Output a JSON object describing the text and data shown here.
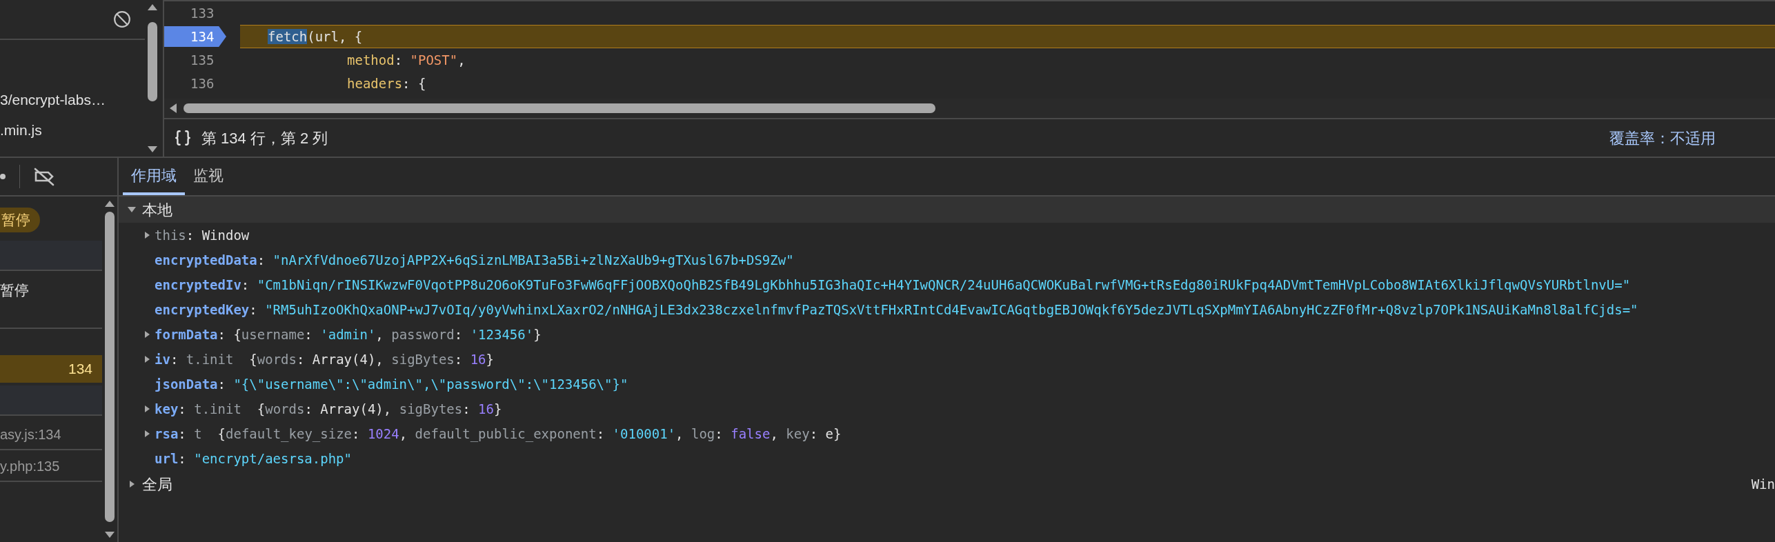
{
  "sources": {
    "files": [
      {
        "name": "3/encrypt-labs…"
      },
      {
        "name": ".min.js"
      }
    ]
  },
  "editor": {
    "lines": [
      {
        "number": "133",
        "paused": false,
        "kind": "blank"
      },
      {
        "number": "134",
        "paused": true,
        "kind": "call",
        "tokens": [
          {
            "text": "fetch",
            "kind": "selected"
          },
          {
            "text": "(url, {",
            "kind": "plain"
          }
        ]
      },
      {
        "number": "135",
        "paused": false,
        "kind": "member",
        "tokens": [
          {
            "text": "method",
            "kind": "property"
          },
          {
            "text": ": ",
            "kind": "plain"
          },
          {
            "text": "\"POST\"",
            "kind": "codestring"
          },
          {
            "text": ",",
            "kind": "plain"
          }
        ]
      },
      {
        "number": "136",
        "paused": false,
        "kind": "member",
        "tokens": [
          {
            "text": "headers",
            "kind": "property"
          },
          {
            "text": ": {",
            "kind": "plain"
          }
        ]
      }
    ]
  },
  "status_bar": {
    "cursor": "第 134 行，第 2 列",
    "coverage": "覆盖率：不适用"
  },
  "debugger_sidebar": {
    "items": [
      {
        "kind": "pill",
        "text": "暂停"
      },
      {
        "kind": "blank"
      },
      {
        "kind": "text",
        "text": "暂停"
      },
      {
        "kind": "breakpoint",
        "text": "134"
      },
      {
        "kind": "blank"
      },
      {
        "kind": "frame",
        "text": "asy.js:134"
      },
      {
        "kind": "frame",
        "text": "y.php:135"
      }
    ]
  },
  "scope_tabs": [
    {
      "label": "作用域",
      "selected": true
    },
    {
      "label": "监视",
      "selected": false
    }
  ],
  "scope": {
    "sections": [
      {
        "label": "本地",
        "expanded": true,
        "children": [
          {
            "name": "this",
            "dimmed": true,
            "expandable": true,
            "value": [
              {
                "text": ": ",
                "kind": "plain"
              },
              {
                "text": "Window",
                "kind": "object"
              }
            ]
          },
          {
            "name": "encryptedData",
            "dimmed": false,
            "expandable": false,
            "value": [
              {
                "text": ": ",
                "kind": "plain"
              },
              {
                "text": "\"nArXfVdnoe67UzojAPP2X+6qSiznLMBAI3a5Bi+zlNzXaUb9+gTXusl67b+DS9Zw\"",
                "kind": "string"
              }
            ]
          },
          {
            "name": "encryptedIv",
            "dimmed": false,
            "expandable": false,
            "value": [
              {
                "text": ": ",
                "kind": "plain"
              },
              {
                "text": "\"Cm1bNiqn/rINSIKwzwF0VqotPP8u2O6oK9TuFo3FwW6qFFjOOBXQoQhB2SfB49LgKbhhu5IG3haQIc+H4YIwQNCR/24uUH6aQCWOKuBalrwfVMG+tRsEdg80iRUkFpq4ADVmtTemHVpLCobo8WIAt6XlkiJflqwQVsYURbtlnvU=\"",
                "kind": "string"
              }
            ]
          },
          {
            "name": "encryptedKey",
            "dimmed": false,
            "expandable": false,
            "value": [
              {
                "text": ": ",
                "kind": "plain"
              },
              {
                "text": "\"RM5uhIzoOKhQxaONP+wJ7vOIq/y0yVwhinxLXaxrO2/nNHGAjLE3dx238czxelnfmvfPazTQSxVttFHxRIntCd4EvawICAGqtbgEBJOWqkf6Y5dezJVTLqSXpMmYIA6AbnyHCzZF0fMr+Q8vzlp7OPk1NSAUiKaMn8l8alfCjds=\"",
                "kind": "string"
              }
            ]
          },
          {
            "name": "formData",
            "dimmed": false,
            "expandable": true,
            "value": [
              {
                "text": ": {",
                "kind": "plain"
              },
              {
                "text": "username",
                "kind": "key"
              },
              {
                "text": ": ",
                "kind": "plain"
              },
              {
                "text": "'admin'",
                "kind": "string"
              },
              {
                "text": ", ",
                "kind": "plain"
              },
              {
                "text": "password",
                "kind": "key"
              },
              {
                "text": ": ",
                "kind": "plain"
              },
              {
                "text": "'123456'",
                "kind": "string"
              },
              {
                "text": "}",
                "kind": "plain"
              }
            ]
          },
          {
            "name": "iv",
            "dimmed": false,
            "expandable": true,
            "value": [
              {
                "text": ": ",
                "kind": "plain"
              },
              {
                "text": "t.init",
                "kind": "class"
              },
              {
                "text": "  {",
                "kind": "plain"
              },
              {
                "text": "words",
                "kind": "key"
              },
              {
                "text": ": ",
                "kind": "plain"
              },
              {
                "text": "Array(4)",
                "kind": "object"
              },
              {
                "text": ", ",
                "kind": "plain"
              },
              {
                "text": "sigBytes",
                "kind": "key"
              },
              {
                "text": ": ",
                "kind": "plain"
              },
              {
                "text": "16",
                "kind": "number"
              },
              {
                "text": "}",
                "kind": "plain"
              }
            ]
          },
          {
            "name": "jsonData",
            "dimmed": false,
            "expandable": false,
            "value": [
              {
                "text": ": ",
                "kind": "plain"
              },
              {
                "text": "\"{\\\"username\\\":\\\"admin\\\",\\\"password\\\":\\\"123456\\\"}\"",
                "kind": "string"
              }
            ]
          },
          {
            "name": "key",
            "dimmed": false,
            "expandable": true,
            "value": [
              {
                "text": ": ",
                "kind": "plain"
              },
              {
                "text": "t.init",
                "kind": "class"
              },
              {
                "text": "  {",
                "kind": "plain"
              },
              {
                "text": "words",
                "kind": "key"
              },
              {
                "text": ": ",
                "kind": "plain"
              },
              {
                "text": "Array(4)",
                "kind": "object"
              },
              {
                "text": ", ",
                "kind": "plain"
              },
              {
                "text": "sigBytes",
                "kind": "key"
              },
              {
                "text": ": ",
                "kind": "plain"
              },
              {
                "text": "16",
                "kind": "number"
              },
              {
                "text": "}",
                "kind": "plain"
              }
            ]
          },
          {
            "name": "rsa",
            "dimmed": false,
            "expandable": true,
            "value": [
              {
                "text": ": ",
                "kind": "plain"
              },
              {
                "text": "t",
                "kind": "class"
              },
              {
                "text": "  {",
                "kind": "plain"
              },
              {
                "text": "default_key_size",
                "kind": "key"
              },
              {
                "text": ": ",
                "kind": "plain"
              },
              {
                "text": "1024",
                "kind": "number"
              },
              {
                "text": ", ",
                "kind": "plain"
              },
              {
                "text": "default_public_exponent",
                "kind": "key"
              },
              {
                "text": ": ",
                "kind": "plain"
              },
              {
                "text": "'010001'",
                "kind": "string"
              },
              {
                "text": ", ",
                "kind": "plain"
              },
              {
                "text": "log",
                "kind": "key"
              },
              {
                "text": ": ",
                "kind": "plain"
              },
              {
                "text": "false",
                "kind": "number"
              },
              {
                "text": ", ",
                "kind": "plain"
              },
              {
                "text": "key",
                "kind": "key"
              },
              {
                "text": ": ",
                "kind": "plain"
              },
              {
                "text": "e",
                "kind": "object"
              },
              {
                "text": "}",
                "kind": "plain"
              }
            ]
          },
          {
            "name": "url",
            "dimmed": false,
            "expandable": false,
            "value": [
              {
                "text": ": ",
                "kind": "plain"
              },
              {
                "text": "\"encrypt/aesrsa.php\"",
                "kind": "string"
              }
            ]
          }
        ]
      },
      {
        "label": "全局",
        "expanded": false,
        "value": "Win"
      }
    ]
  }
}
